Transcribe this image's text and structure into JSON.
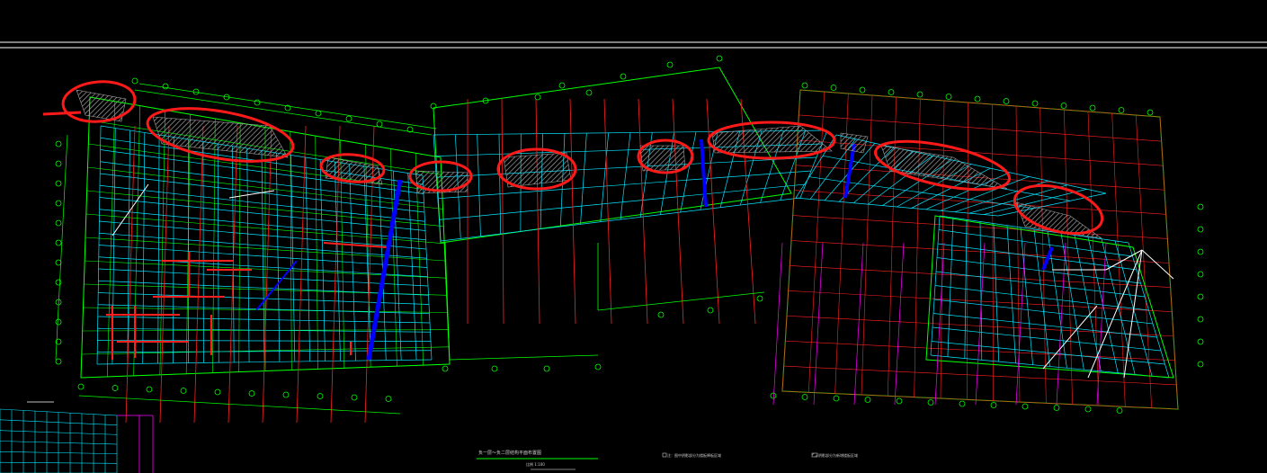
{
  "drawing": {
    "title": "负一层～负二层结构平面布置图",
    "scale_note": "比例 1:100",
    "legend_items": [
      "注：图中阴影部分为楼板降板区域",
      "阴影部分为新增楼板区域"
    ]
  },
  "colors": {
    "background": "#000000",
    "frame_line": "#ffffff",
    "grid_axis": "#00ff00",
    "beam": "#00e5ff",
    "column_line": "#ff2020",
    "dim_line": "#ff00ff",
    "highlight_wall": "#0000ff",
    "hatch": "#a0a0a0",
    "markup_circle": "#ff1a1a"
  },
  "markup": {
    "description_count": 11
  }
}
